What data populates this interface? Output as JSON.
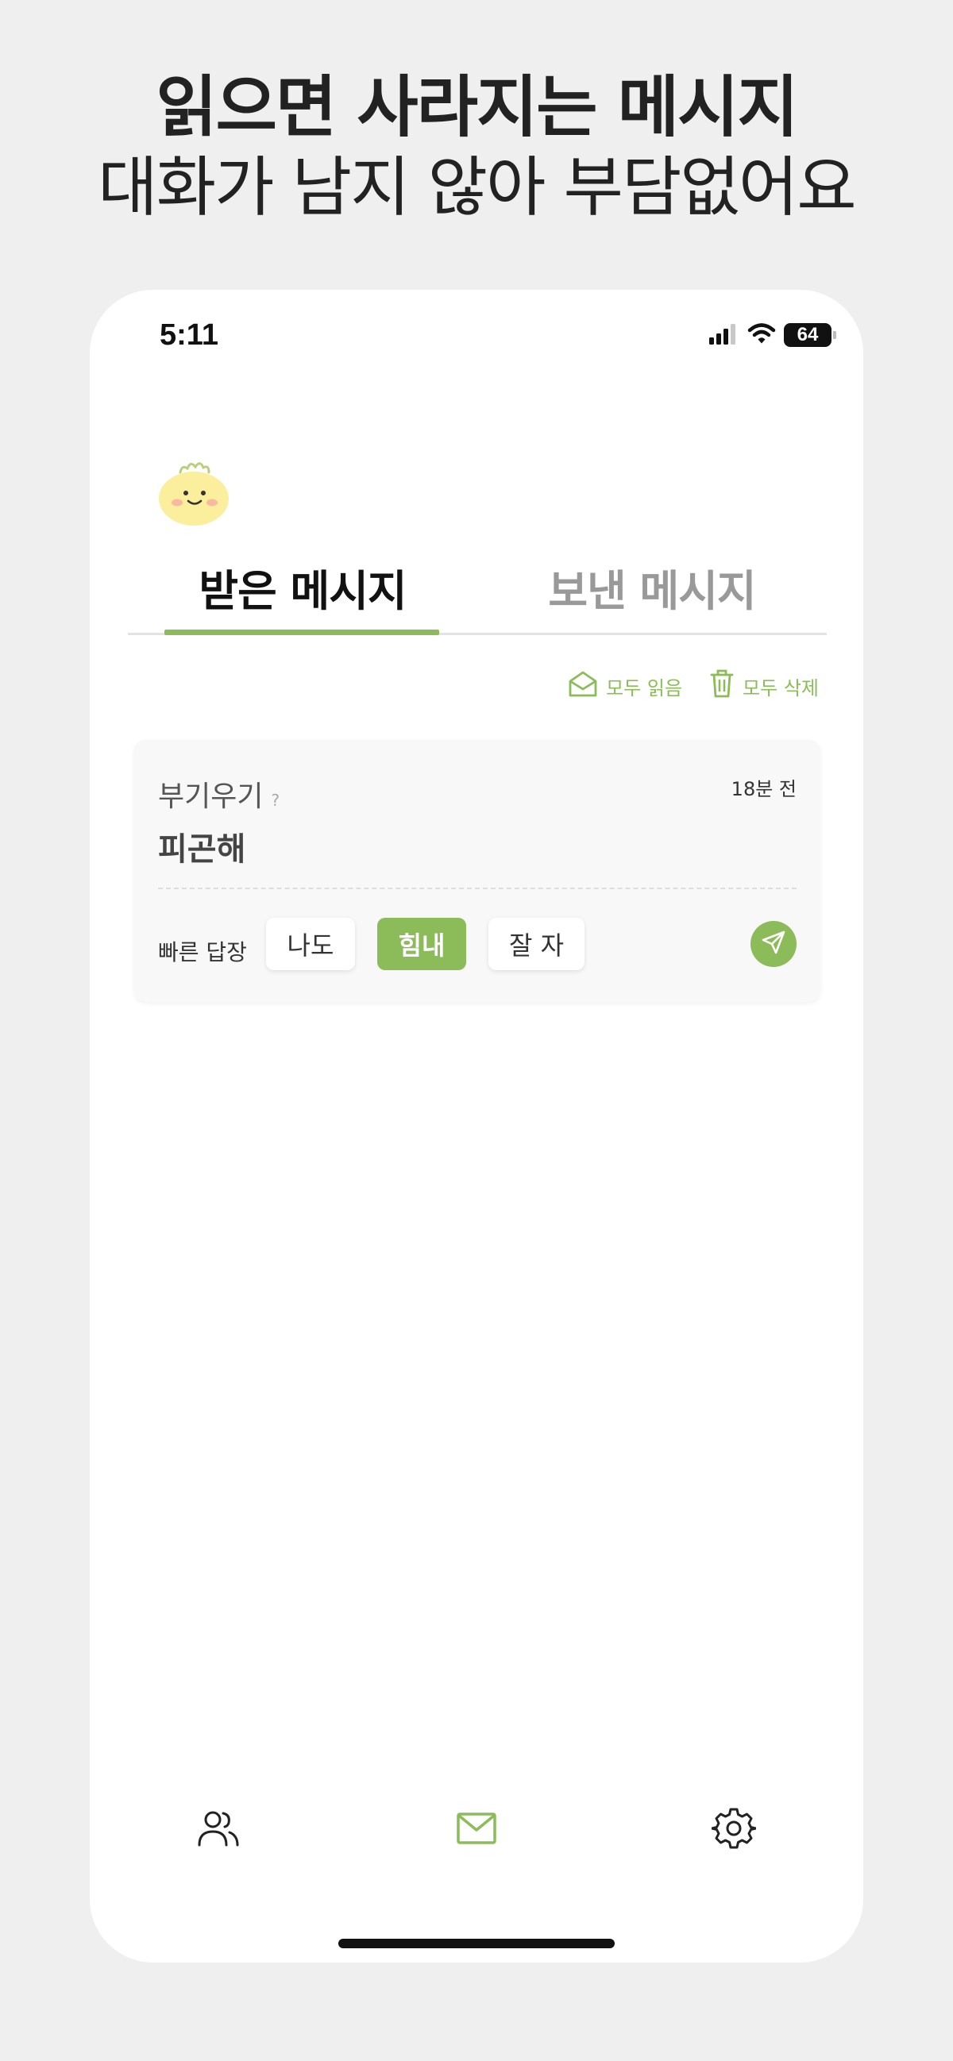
{
  "headline": {
    "line1": "읽으면 사라지는 메시지",
    "line2": "대화가 남지 않아 부담없어요"
  },
  "status_bar": {
    "time": "5:11",
    "battery": "64"
  },
  "tabs": [
    {
      "label": "받은 메시지",
      "selected": true
    },
    {
      "label": "보낸 메시지",
      "selected": false
    }
  ],
  "actions": {
    "read_all": "모두 읽음",
    "delete_all": "모두 삭제"
  },
  "message": {
    "sender": "부기우기",
    "sender_mark": "?",
    "time_ago": "18분 전",
    "text": "피곤해",
    "quick_reply_label": "빠른 답장",
    "quick_replies": [
      "나도",
      "힘내",
      "잘 자"
    ],
    "selected_reply": "힘내"
  },
  "colors": {
    "accent": "#8cbb5a",
    "background": "#efefef",
    "card": "#f8f8f8"
  },
  "icons": {
    "status": [
      "signal-icon",
      "wifi-icon",
      "battery-icon"
    ],
    "nav": [
      "friends-icon",
      "mail-icon",
      "gear-icon"
    ]
  }
}
